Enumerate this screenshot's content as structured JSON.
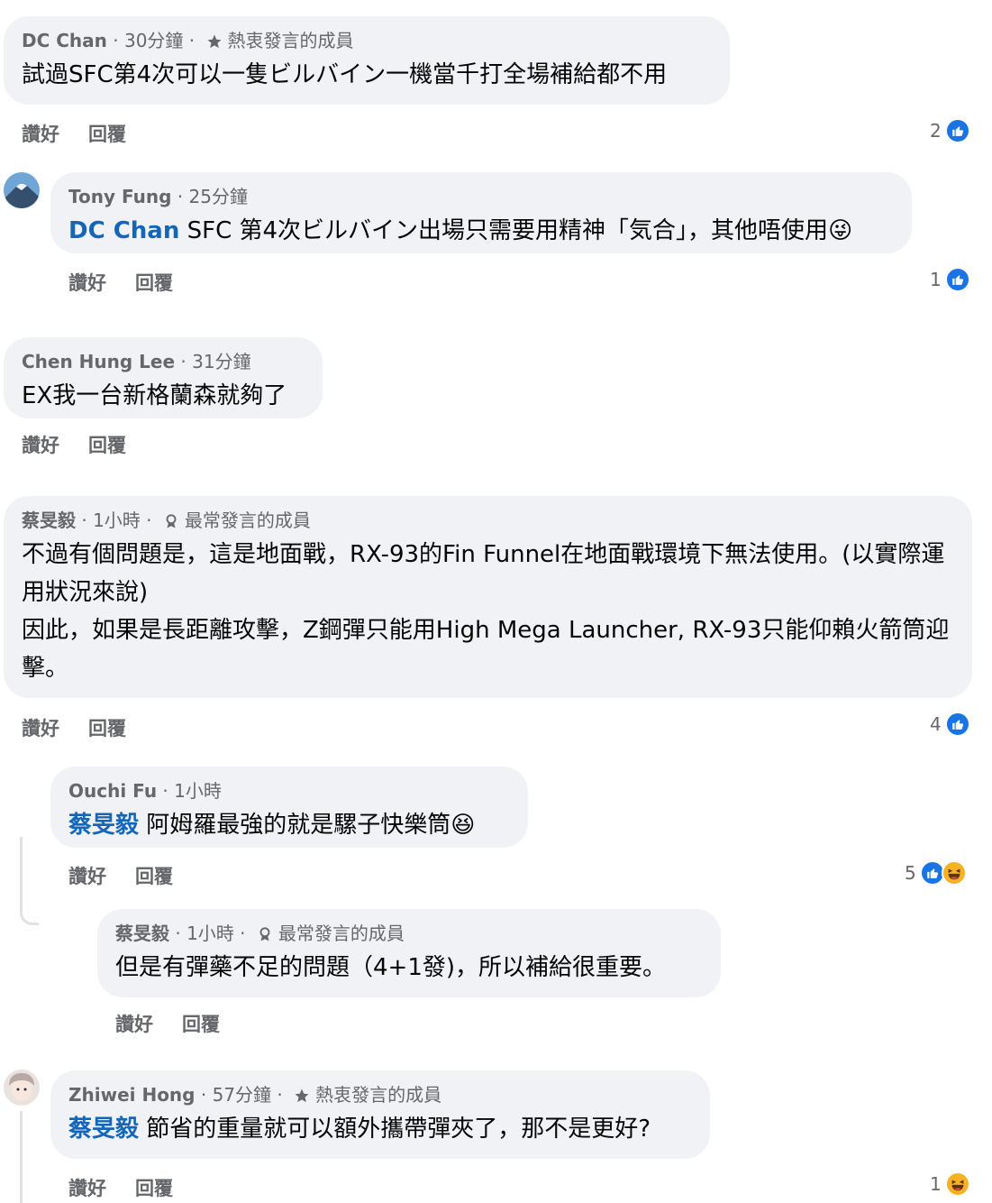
{
  "actions": {
    "like": "讚好",
    "reply": "回覆"
  },
  "comments": [
    {
      "name": "DC  Chan",
      "time": "30分鐘",
      "badge": "熱衷發言的成員",
      "text": "試過SFC第4次可以一隻ビルバイン一機當千打全場補給都不用",
      "likes": "2"
    },
    {
      "name": "Tony Fung",
      "time": "25分鐘",
      "mention": "DC  Chan",
      "text": " SFC 第4次ビルバイン出場只需要用精神「気合」，其他唔使用",
      "emoji": "😜",
      "likes": "1"
    },
    {
      "name": "Chen Hung Lee",
      "time": "31分鐘",
      "text": "EX我一台新格蘭森就夠了"
    },
    {
      "name": "蔡旻毅",
      "time": "1小時",
      "badge": "最常發言的成員",
      "text": "不過有個問題是，這是地面戰，RX-93的Fin Funnel在地面戰環境下無法使用。(以實際運用狀況來說)\n因此，如果是長距離攻擊，Z鋼彈只能用High Mega Launcher, RX-93只能仰賴火箭筒迎擊。",
      "likes": "4"
    },
    {
      "name": "Ouchi Fu",
      "time": "1小時",
      "mention": "蔡旻毅",
      "text": " 阿姆羅最強的就是騾子快樂筒",
      "emoji": "😆",
      "likes": "5"
    },
    {
      "name": "蔡旻毅",
      "time": "1小時",
      "badge": "最常發言的成員",
      "text": "但是有彈藥不足的問題（4+1發)，所以補給很重要。"
    },
    {
      "name": "Zhiwei Hong",
      "time": "57分鐘",
      "badge": "熱衷發言的成員",
      "mention": "蔡旻毅",
      "text": " 節省的重量就可以額外攜帶彈夾了，那不是更好?",
      "likes": "1"
    }
  ],
  "colors": {
    "bubble": "#f0f2f5",
    "mention": "#1467b8",
    "like": "#1b74e4",
    "muted": "#65676b"
  }
}
